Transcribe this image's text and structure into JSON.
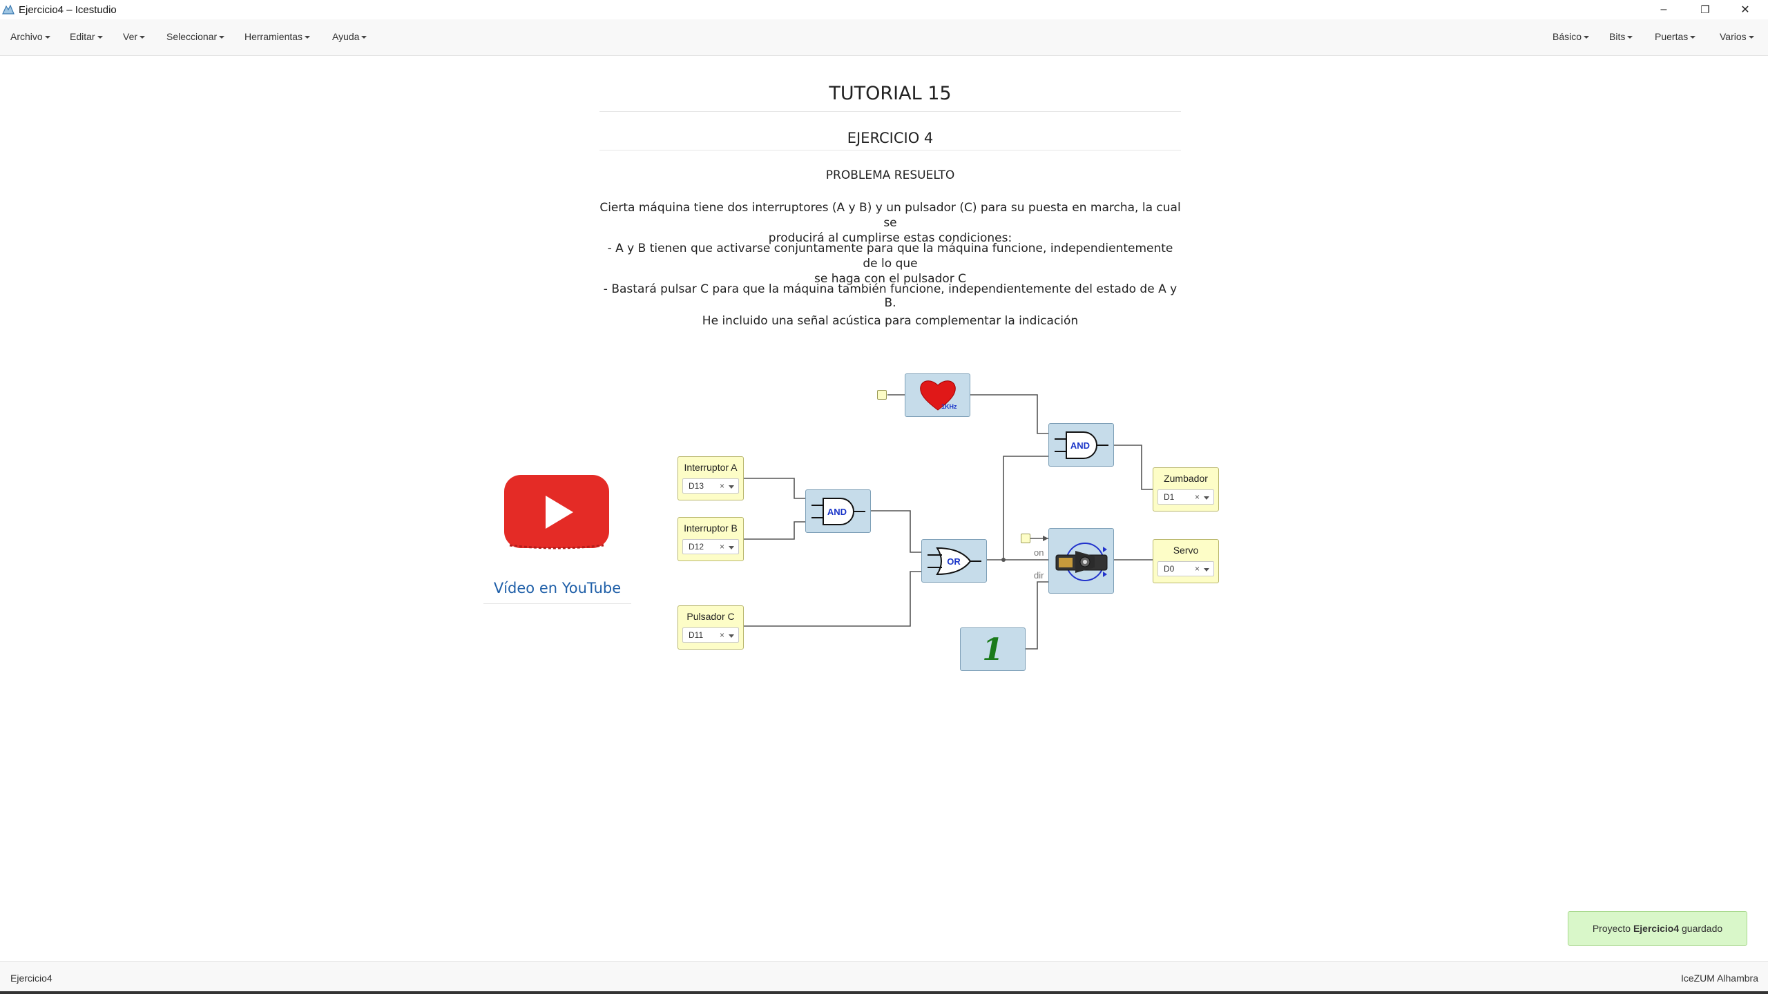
{
  "window": {
    "title": "Ejercicio4 – Icestudio",
    "minimize": "–",
    "restore": "❐",
    "close": "✕"
  },
  "menu": {
    "left": [
      "Archivo",
      "Editar",
      "Ver",
      "Seleccionar",
      "Herramientas",
      "Ayuda"
    ],
    "right": [
      "Básico",
      "Bits",
      "Puertas",
      "Varios"
    ]
  },
  "doc": {
    "title": "TUTORIAL 15",
    "subtitle": "EJERCICIO 4",
    "heading": "PROBLEMA RESUELTO",
    "para1_line1": "Cierta máquina tiene dos interruptores (A y B) y un pulsador (C) para su puesta en marcha, la cual se",
    "para1_line2": "producirá al cumplirse estas condiciones:",
    "para2_line1": "- A y B tienen que activarse conjuntamente para que la máquina funcione, independientemente de lo que",
    "para2_line2": "se haga con el pulsador C",
    "para3": "- Bastará pulsar C para que la máquina también funcione, independientemente del estado de A y B.",
    "para4": "He incluido una señal acústica para complementar la indicación"
  },
  "video": {
    "link": "Vídeo en YouTube",
    "icon": "youtube-play-icon"
  },
  "circuit": {
    "inputs": [
      {
        "label": "Interruptor A",
        "pin": "D13"
      },
      {
        "label": "Interruptor B",
        "pin": "D12"
      },
      {
        "label": "Pulsador C",
        "pin": "D11"
      }
    ],
    "outputs": [
      {
        "label": "Zumbador",
        "pin": "D1"
      },
      {
        "label": "Servo",
        "pin": "D0"
      }
    ],
    "clear_glyph": "×",
    "gates": {
      "and": "AND",
      "or": "OR"
    },
    "clock_label": "1KHz",
    "servo_ports": {
      "on": "on",
      "dir": "dir"
    },
    "constant_value": "1",
    "icons": [
      "heart-clock-icon",
      "servo-motor-icon"
    ]
  },
  "toast": {
    "prefix": "Proyecto",
    "project": "Ejercicio4",
    "suffix": "guardado"
  },
  "footer": {
    "project": "Ejercicio4",
    "board": "IceZUM Alhambra"
  },
  "colors": {
    "block_blue": "#c6dcea",
    "block_yellow": "#fdfdc7",
    "gate_text": "#1a35c8",
    "youtube_red": "#e42b26",
    "link_blue": "#1f5fa8",
    "toast_green": "#d9f7c9"
  }
}
